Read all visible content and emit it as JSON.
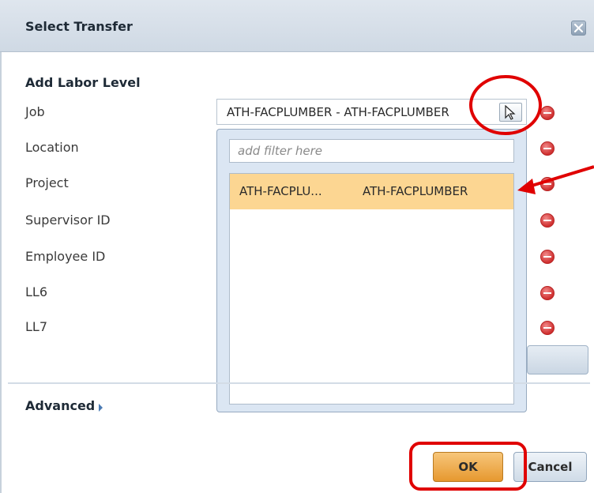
{
  "dialog": {
    "title": "Select Transfer",
    "close_icon": "close-icon"
  },
  "form": {
    "section_title": "Add Labor Level",
    "fields": [
      {
        "label": "Job"
      },
      {
        "label": "Location"
      },
      {
        "label": "Project"
      },
      {
        "label": "Supervisor ID"
      },
      {
        "label": "Employee ID"
      },
      {
        "label": "LL6"
      },
      {
        "label": "LL7"
      }
    ],
    "job_value": "ATH-FACPLUMBER - ATH-FACPLUMBER",
    "remove_icon": "remove-icon"
  },
  "dropdown": {
    "filter_placeholder": "add filter here",
    "items": [
      {
        "code": "ATH-FACPLU...",
        "description": "ATH-FACPLUMBER",
        "selected": true
      }
    ]
  },
  "advanced": {
    "label": "Advanced"
  },
  "buttons": {
    "ok": "OK",
    "cancel": "Cancel"
  },
  "colors": {
    "annotation": "#e00000",
    "selected_row": "#fcd692",
    "ok_button": "#e6982f",
    "titlebar": "#d6dfe9"
  }
}
